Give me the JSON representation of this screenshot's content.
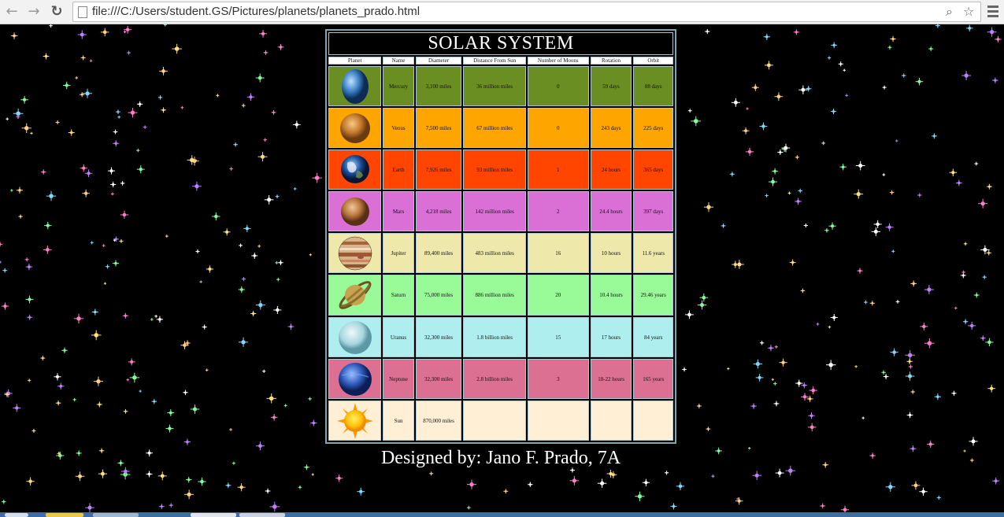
{
  "browser": {
    "url": "file:///C:/Users/student.GS/Pictures/planets/planets_prado.html",
    "icons": [
      "back-arrow-icon",
      "forward-arrow-icon",
      "reload-icon",
      "page-icon",
      "zoom-icon",
      "star-icon",
      "menu-icon"
    ]
  },
  "table": {
    "title": "SOLAR SYSTEM",
    "headers": [
      "Planet",
      "Name",
      "Diameter",
      "Distance From Sun",
      "Number of Moons",
      "Rotation",
      "Orbit"
    ],
    "rows": [
      {
        "name": "Mercury",
        "diameter": "3,100 miles",
        "distance": "36 million miles",
        "moons": "0",
        "rotation": "59 days",
        "orbit": "88 days",
        "color": "#6b8e23",
        "icon": "mercury-icon"
      },
      {
        "name": "Venus",
        "diameter": "7,500 miles",
        "distance": "67 million miles",
        "moons": "0",
        "rotation": "243 days",
        "orbit": "225 days",
        "color": "#ffa500",
        "icon": "venus-icon"
      },
      {
        "name": "Earth",
        "diameter": "7,926 miles",
        "distance": "93 million miles",
        "moons": "1",
        "rotation": "24 hours",
        "orbit": "365 days",
        "color": "#ff4500",
        "icon": "earth-icon"
      },
      {
        "name": "Mars",
        "diameter": "4,218 miles",
        "distance": "142 million miles",
        "moons": "2",
        "rotation": "24.4 hours",
        "orbit": "397 days",
        "color": "#da70d6",
        "icon": "mars-icon"
      },
      {
        "name": "Jupiter",
        "diameter": "89,400 miles",
        "distance": "483 million miles",
        "moons": "16",
        "rotation": "10 hours",
        "orbit": "11.6 years",
        "color": "#eee8aa",
        "icon": "jupiter-icon"
      },
      {
        "name": "Saturn",
        "diameter": "75,000 miles",
        "distance": "886 million miles",
        "moons": "20",
        "rotation": "10.4 hours",
        "orbit": "29.46 years",
        "color": "#98fb98",
        "icon": "saturn-icon"
      },
      {
        "name": "Uranus",
        "diameter": "32,300 miles",
        "distance": "1.8 billion miles",
        "moons": "15",
        "rotation": "17 hours",
        "orbit": "84 years",
        "color": "#afeeee",
        "icon": "uranus-icon"
      },
      {
        "name": "Neptune",
        "diameter": "32,300 miles",
        "distance": "2.8 billion miles",
        "moons": "3",
        "rotation": "18-22 hours",
        "orbit": "165 years",
        "color": "#db7093",
        "icon": "neptune-icon"
      },
      {
        "name": "Sun",
        "diameter": "870,000 miles",
        "distance": "",
        "moons": "",
        "rotation": "",
        "orbit": "",
        "color": "#ffefd5",
        "icon": "sun-icon"
      }
    ]
  },
  "footer": {
    "credit": "Designed by: Jano F. Prado, 7A"
  }
}
